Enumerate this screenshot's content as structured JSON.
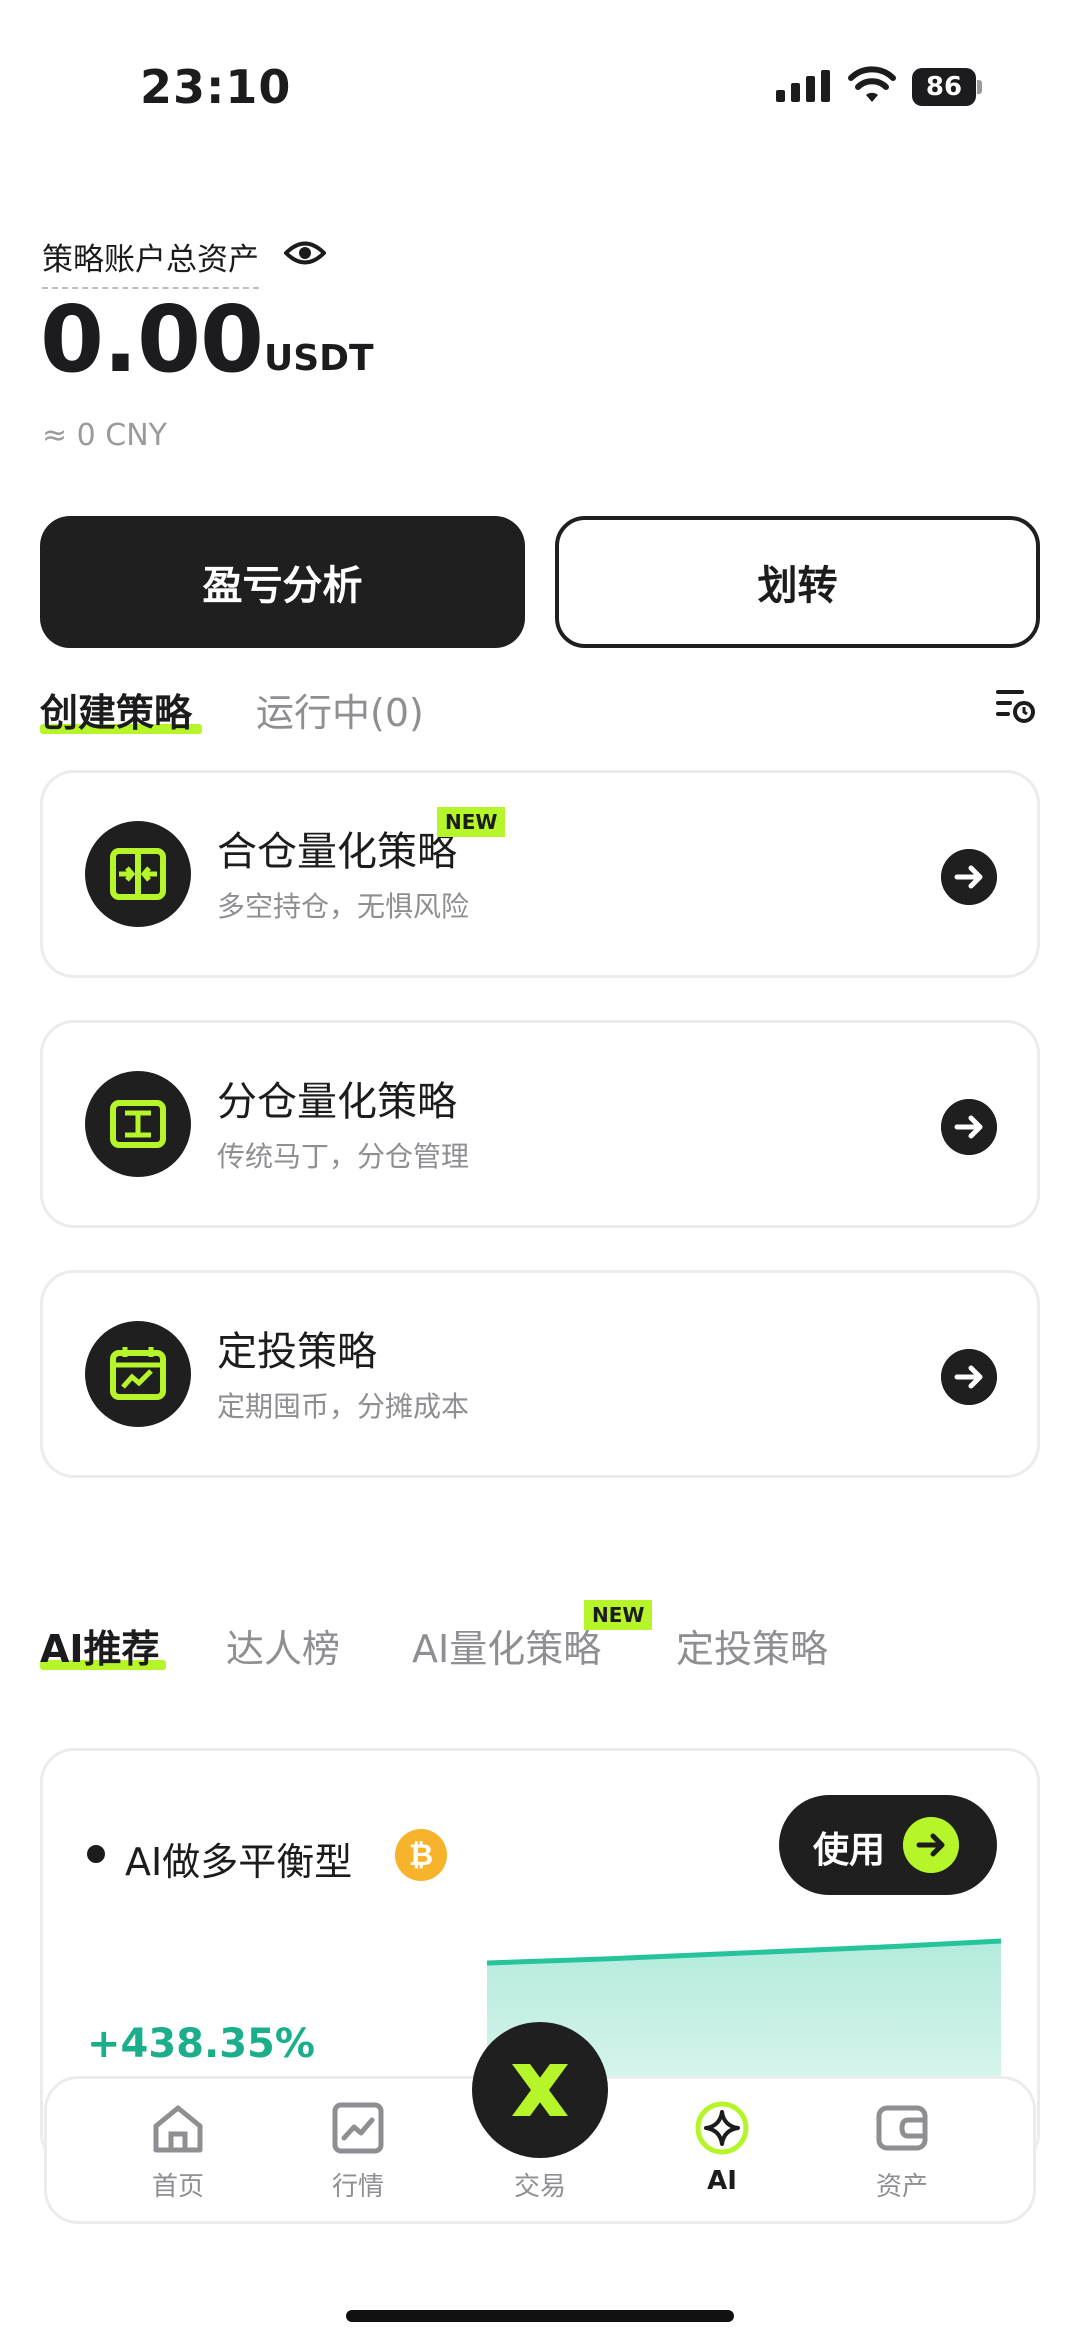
{
  "status": {
    "time": "23:10",
    "battery": "86"
  },
  "account": {
    "label": "策略账户总资产",
    "balance": "0.00",
    "unit": "USDT",
    "cny": "≈ 0 CNY"
  },
  "actions": {
    "pnl_label": "盈亏分析",
    "transfer_label": "划转"
  },
  "strategy_tabs": [
    {
      "label": "创建策略",
      "active": true
    },
    {
      "label": "运行中(0)",
      "active": false
    }
  ],
  "strategies": [
    {
      "title": "合仓量化策略",
      "subtitle": "多空持仓，无惧风险",
      "badge": "NEW"
    },
    {
      "title": "分仓量化策略",
      "subtitle": "传统马丁，分仓管理"
    },
    {
      "title": "定投策略",
      "subtitle": "定期囤币，分摊成本"
    }
  ],
  "rec_tabs": [
    {
      "label": "AI推荐",
      "active": true
    },
    {
      "label": "达人榜",
      "active": false
    },
    {
      "label": "AI量化策略",
      "active": false,
      "badge": "NEW"
    },
    {
      "label": "定投策略",
      "active": false
    }
  ],
  "recommendation": {
    "title": "AI做多平衡型",
    "coin_icon": "bitcoin-icon",
    "use_label": "使用",
    "return_pct": "+438.35%",
    "accent": "#b6f52a",
    "chart_color": "#26c49a"
  },
  "nav": [
    {
      "label": "首页",
      "icon": "home-icon"
    },
    {
      "label": "行情",
      "icon": "chart-icon"
    },
    {
      "label": "交易",
      "icon": "trade-icon"
    },
    {
      "label": "AI",
      "icon": "ai-icon",
      "active": true
    },
    {
      "label": "资产",
      "icon": "wallet-icon"
    }
  ]
}
